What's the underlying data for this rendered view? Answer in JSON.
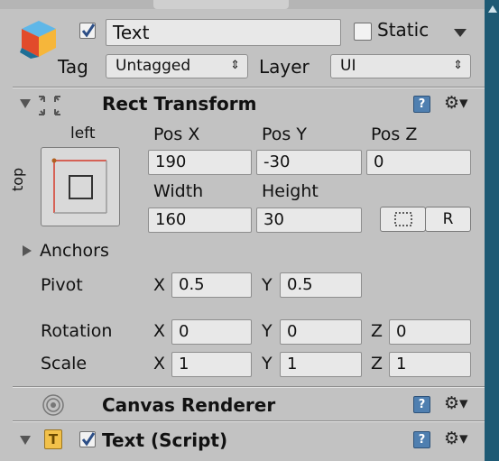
{
  "object": {
    "icon": "cube-icon",
    "enabled": true,
    "name": "Text",
    "static_label": "Static",
    "static_checked": false,
    "tag_label": "Tag",
    "tag_value": "Untagged",
    "layer_label": "Layer",
    "layer_value": "UI"
  },
  "rect_transform": {
    "title": "Rect Transform",
    "anchor_preset_h": "left",
    "anchor_preset_v": "top",
    "pos_x_label": "Pos X",
    "pos_y_label": "Pos Y",
    "pos_z_label": "Pos Z",
    "pos_x": "190",
    "pos_y": "-30",
    "pos_z": "0",
    "width_label": "Width",
    "height_label": "Height",
    "width": "160",
    "height": "30",
    "raw_button": "R",
    "anchors_label": "Anchors",
    "pivot_label": "Pivot",
    "pivot_x": "0.5",
    "pivot_y": "0.5",
    "rotation_label": "Rotation",
    "rotation": {
      "x": "0",
      "y": "0",
      "z": "0"
    },
    "scale_label": "Scale",
    "scale": {
      "x": "1",
      "y": "1",
      "z": "1"
    },
    "axis": {
      "x": "X",
      "y": "Y",
      "z": "Z"
    }
  },
  "canvas_renderer": {
    "title": "Canvas Renderer"
  },
  "text_script": {
    "title": "Text (Script)",
    "enabled": true,
    "icon_letter": "T"
  },
  "colors": {
    "panel": "#c2c2c2",
    "field": "#e8e8e8",
    "help": "#4f7fb0",
    "rightbar": "#1e5a74",
    "anchor_red": "#d43a2a"
  }
}
